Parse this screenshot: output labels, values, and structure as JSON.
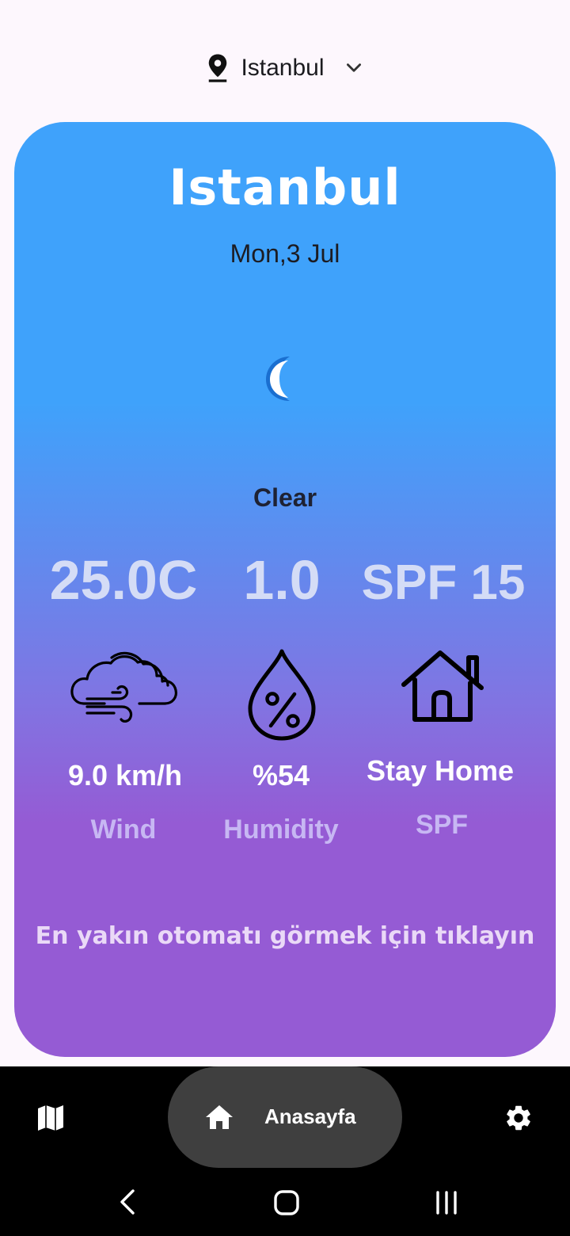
{
  "location_selector": {
    "city": "Istanbul",
    "pin_icon": "location-pin-icon",
    "dropdown_icon": "chevron-down-icon"
  },
  "card": {
    "city": "Istanbul",
    "date": "Mon,3 Jul",
    "weather_icon": "moon-icon",
    "condition": "Clear",
    "temperature": "25.0C",
    "uv_index": "1.0",
    "spf": "SPF 15",
    "wind": {
      "icon": "wind-cloud-icon",
      "value": "9.0 km/h",
      "label": "Wind"
    },
    "humidity": {
      "icon": "humidity-drop-icon",
      "value": "%54",
      "label": "Humidity"
    },
    "advice": {
      "icon": "house-icon",
      "value": "Stay Home",
      "label": "SPF"
    },
    "nearest_link": "En yakın otomatı görmek için tıklayın",
    "colors": {
      "top": "#3fa2fb",
      "bottom": "#955bd4"
    }
  },
  "bottom_nav": {
    "items": [
      {
        "icon": "map-icon",
        "label": ""
      },
      {
        "icon": "home-icon",
        "label": "Anasayfa",
        "active": true
      },
      {
        "icon": "gear-icon",
        "label": ""
      }
    ]
  },
  "system_nav": {
    "back_icon": "back-icon",
    "home_icon": "home-circle-icon",
    "recents_icon": "recents-icon"
  }
}
